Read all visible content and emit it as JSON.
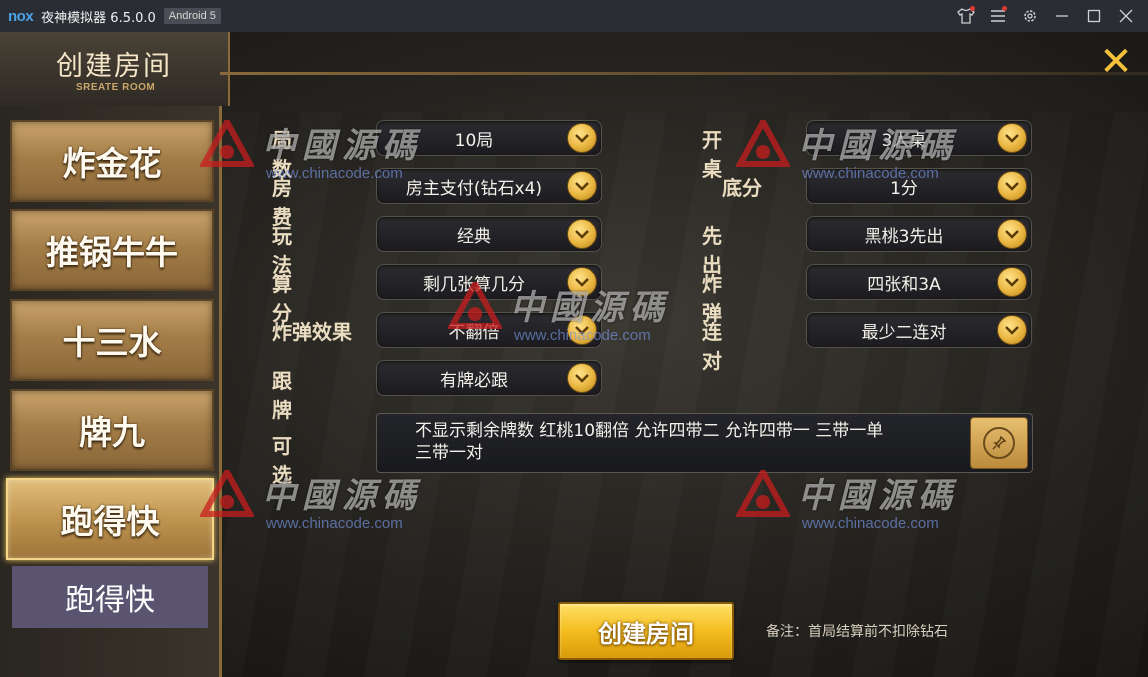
{
  "titlebar": {
    "logo": "nox",
    "app_title": "夜神模拟器 6.5.0.0",
    "android": "Android 5",
    "icons": [
      "shirt-icon",
      "menu-icon",
      "gear-icon",
      "minimize-icon",
      "maximize-icon",
      "close-icon"
    ]
  },
  "header": {
    "title": "创建房间",
    "subtitle": "SREATE ROOM",
    "close": "✕"
  },
  "sidebar": {
    "items": [
      {
        "label": "炸金花"
      },
      {
        "label": "推锅牛牛"
      },
      {
        "label": "十三水"
      },
      {
        "label": "牌九"
      },
      {
        "label": "跑得快"
      }
    ],
    "active": "跑得快",
    "sub_item": "跑得快"
  },
  "form": {
    "left": [
      {
        "label": "局数",
        "value": "10局"
      },
      {
        "label": "房费",
        "value": "房主支付(钻石x4)"
      },
      {
        "label": "玩法",
        "value": "经典"
      },
      {
        "label": "算分",
        "value": "剩几张算几分"
      },
      {
        "label": "炸弹效果",
        "value": "不翻倍"
      },
      {
        "label": "跟牌",
        "value": "有牌必跟"
      }
    ],
    "right": [
      {
        "label": "开桌",
        "value": "3人桌"
      },
      {
        "label": "底分",
        "value": "1分"
      },
      {
        "label": "先出",
        "value": "黑桃3先出"
      },
      {
        "label": "炸弹",
        "value": "四张和3A"
      },
      {
        "label": "连对",
        "value": "最少二连对"
      }
    ],
    "optional_label": "可选",
    "optional_line1": "不显示剩余牌数 红桃10翻倍 允许四带二 允许四带一 三带一单",
    "optional_line2": "三带一对"
  },
  "create_button": "创建房间",
  "note": "备注：首局结算前不扣除钻石",
  "watermark": {
    "cn": "中國源碼",
    "url": "www.chinacode.com"
  },
  "colors": {
    "accent_gold": "#f3c23a",
    "sidebar_active": "#e0be7a",
    "sub_item_bg": "#5a5470"
  }
}
